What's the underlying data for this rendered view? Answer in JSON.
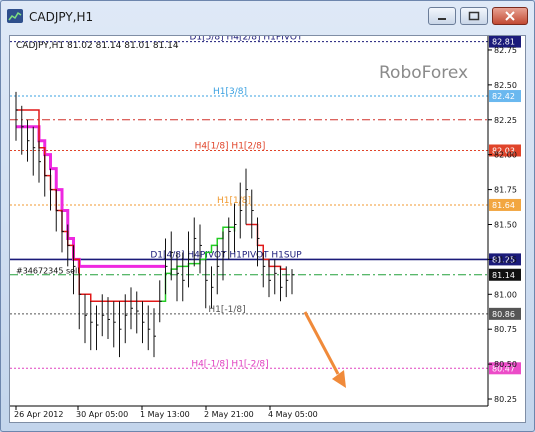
{
  "window": {
    "title": "CADJPY,H1"
  },
  "chart_data": {
    "type": "line",
    "symbol": "CADJPY,H1",
    "ohlc_header": "CADJPY,H1  81.02 81.14 81.01 81.14",
    "watermark": "RoboForex",
    "ylim": [
      80.2,
      82.85
    ],
    "y_ticks": [
      "82.75",
      "82.50",
      "82.25",
      "82.00",
      "81.75",
      "81.50",
      "81.25",
      "81.00",
      "80.75",
      "80.50",
      "80.25"
    ],
    "x_ticks": [
      "26 Apr 2012",
      "30 Apr 05:00",
      "1 May 13:00",
      "2 May 21:00",
      "4 May 05:00"
    ],
    "levels": [
      {
        "label": "D1[5/8] H4[2/8] H1PIVOT",
        "price_tag": "82.81",
        "value": 82.81,
        "color": "#1b1b7a",
        "tag_bg": "#1b1b7a",
        "tag_color": "#ffffff",
        "style": "dash"
      },
      {
        "label": "H1[3/8]",
        "price_tag": "82.42",
        "value": 82.42,
        "color": "#3aa0e0",
        "tag_bg": "#6ab8ef",
        "tag_color": "#ffffff",
        "style": "dash"
      },
      {
        "label": "",
        "price_tag": "",
        "value": 82.25,
        "color": "#d0302a",
        "tag_bg": "",
        "tag_color": "",
        "style": "dashdot"
      },
      {
        "label": "H4[1/8] H1[2/8]",
        "price_tag": "82.03",
        "value": 82.03,
        "color": "#e0442a",
        "tag_bg": "#e0442a",
        "tag_color": "#ffffff",
        "style": "dash"
      },
      {
        "label": "H1[1/8]",
        "price_tag": "81.64",
        "value": 81.64,
        "color": "#f09a30",
        "tag_bg": "#f2a640",
        "tag_color": "#ffffff",
        "style": "dash"
      },
      {
        "label": "D1[4/8] H4PIVOT H1PIVOT H1SUP",
        "price_tag": "81.25",
        "value": 81.25,
        "color": "#1b1b7a",
        "tag_bg": "#1b1b7a",
        "tag_color": "#ffffff",
        "style": "solid"
      },
      {
        "label": "",
        "price_tag": "81.14",
        "value": 81.14,
        "color": "#22a03a",
        "tag_bg": "#111111",
        "tag_color": "#ffffff",
        "style": "dashdot"
      },
      {
        "label": "H1[-1/8]",
        "price_tag": "80.86",
        "value": 80.86,
        "color": "#555555",
        "tag_bg": "#555555",
        "tag_color": "#ffffff",
        "style": "dash"
      },
      {
        "label": "H4[-1/8] H1[-2/8]",
        "price_tag": "80.47",
        "value": 80.47,
        "color": "#e040c0",
        "tag_bg": "#ec4cc8",
        "tag_color": "#ffffff",
        "style": "dash"
      }
    ],
    "order_label": "#34672345 sell",
    "order_value": 81.17,
    "close": [
      82.32,
      82.2,
      82.1,
      82.05,
      81.95,
      81.85,
      81.75,
      81.6,
      81.45,
      81.35,
      81.2,
      81.0,
      80.85,
      80.8,
      80.78,
      80.85,
      80.82,
      80.8,
      80.75,
      80.85,
      80.9,
      80.88,
      80.8,
      80.75,
      80.7,
      80.95,
      81.2,
      81.3,
      81.15,
      81.1,
      81.25,
      81.4,
      81.35,
      81.1,
      81.05,
      81.2,
      81.3,
      81.45,
      81.5,
      81.6,
      81.75,
      81.6,
      81.4,
      81.2,
      81.1,
      81.15,
      81.05,
      81.1,
      81.14
    ],
    "high": [
      82.45,
      82.35,
      82.25,
      82.2,
      82.1,
      82.0,
      81.9,
      81.75,
      81.6,
      81.5,
      81.35,
      81.15,
      81.0,
      80.95,
      80.92,
      81.0,
      80.98,
      80.95,
      80.95,
      81.0,
      81.05,
      81.02,
      80.95,
      80.92,
      80.9,
      81.1,
      81.4,
      81.45,
      81.3,
      81.3,
      81.45,
      81.55,
      81.5,
      81.25,
      81.2,
      81.35,
      81.45,
      81.55,
      81.65,
      81.8,
      81.9,
      81.75,
      81.55,
      81.3,
      81.25,
      81.25,
      81.2,
      81.2,
      81.18
    ],
    "low": [
      82.1,
      82.0,
      81.95,
      81.85,
      81.8,
      81.7,
      81.6,
      81.45,
      81.3,
      81.2,
      81.0,
      80.75,
      80.65,
      80.6,
      80.6,
      80.7,
      80.68,
      80.62,
      80.55,
      80.65,
      80.75,
      80.72,
      80.65,
      80.6,
      80.55,
      80.8,
      81.0,
      81.1,
      80.95,
      80.95,
      81.05,
      81.2,
      81.15,
      80.9,
      80.9,
      81.0,
      81.1,
      81.25,
      81.3,
      81.4,
      81.5,
      81.4,
      81.2,
      81.05,
      80.98,
      81.0,
      80.95,
      80.98,
      81.0
    ],
    "trail_red": [
      82.32,
      82.32,
      82.32,
      82.32,
      82.05,
      81.85,
      81.75,
      81.6,
      81.45,
      81.35,
      81.25,
      81.0,
      81.0,
      80.95,
      80.95,
      80.95,
      80.95,
      80.95,
      80.95,
      80.95,
      80.95,
      80.95,
      80.95,
      80.95,
      80.95,
      80.95,
      80.95
    ],
    "trail_magenta": [
      82.2,
      82.2,
      82.2,
      82.2,
      82.1,
      82.0,
      81.9,
      81.75,
      81.6,
      81.4,
      81.25,
      81.2,
      81.2,
      81.2,
      81.2,
      81.2,
      81.2,
      81.2,
      81.2,
      81.2,
      81.2,
      81.2,
      81.2,
      81.2,
      81.2,
      81.2,
      81.2
    ],
    "trail_green": [
      80.95,
      81.15,
      81.18,
      81.2,
      81.2,
      81.22,
      81.22,
      81.25,
      81.3,
      81.35,
      81.4,
      81.48,
      81.48,
      81.45
    ],
    "trail_red_late": [
      81.5,
      81.5,
      81.35,
      81.25,
      81.2,
      81.2,
      81.18,
      81.18
    ],
    "arrow_color": "#f08a3a"
  }
}
